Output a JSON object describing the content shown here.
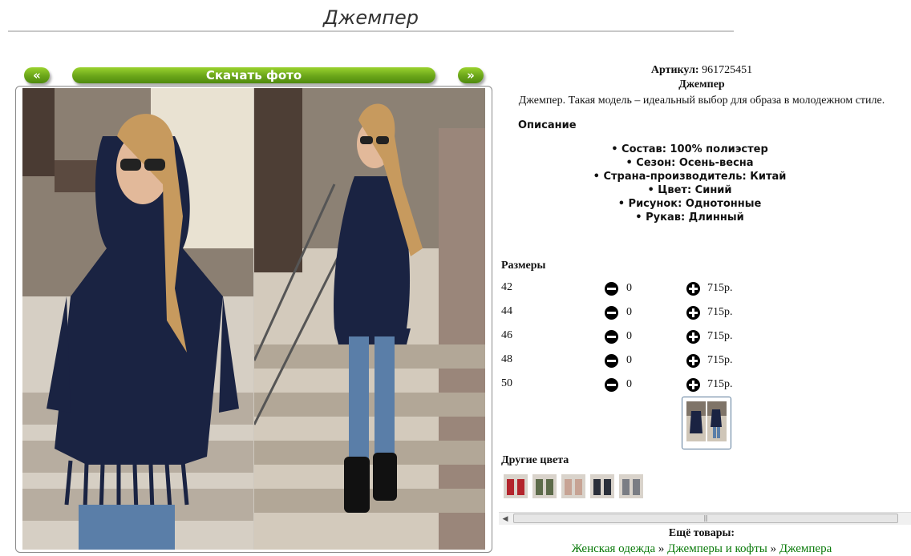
{
  "page": {
    "title": "Джемпер"
  },
  "nav": {
    "prev": "«",
    "next": "»",
    "download": "Скачать фото"
  },
  "product": {
    "article_label": "Артикул:",
    "article_value": "961725451",
    "name": "Джемпер",
    "tagline": "Джемпер. Такая модель – идеальный выбор для образа в молодежном стиле.",
    "description_heading": "Описание",
    "properties": [
      "• Состав: 100% полиэстер",
      "• Сезон: Осень-весна",
      "• Страна-производитель: Китай",
      "• Цвет: Синий",
      "• Рисунок: Однотонные",
      "• Рукав: Длинный"
    ]
  },
  "sizes": {
    "heading": "Размеры",
    "rows": [
      {
        "size": "42",
        "qty": "0",
        "price": "715р."
      },
      {
        "size": "44",
        "qty": "0",
        "price": "715р."
      },
      {
        "size": "46",
        "qty": "0",
        "price": "715р."
      },
      {
        "size": "48",
        "qty": "0",
        "price": "715р."
      },
      {
        "size": "50",
        "qty": "0",
        "price": "715р."
      }
    ]
  },
  "other_colors": {
    "heading": "Другие цвета",
    "swatches": [
      "#b3242c",
      "#5d6b4a",
      "#c7a394",
      "#2a2f3a",
      "#7a7d84"
    ]
  },
  "more_goods": {
    "heading": "Ещё товары:",
    "crumbs": [
      "Женская одежда",
      "Джемперы и кофты",
      "Джемпера"
    ],
    "separator": "»"
  },
  "colors": {
    "accent_green": "#6aa519",
    "link_green": "#0a7a0a",
    "sweater_navy": "#1a2342"
  }
}
